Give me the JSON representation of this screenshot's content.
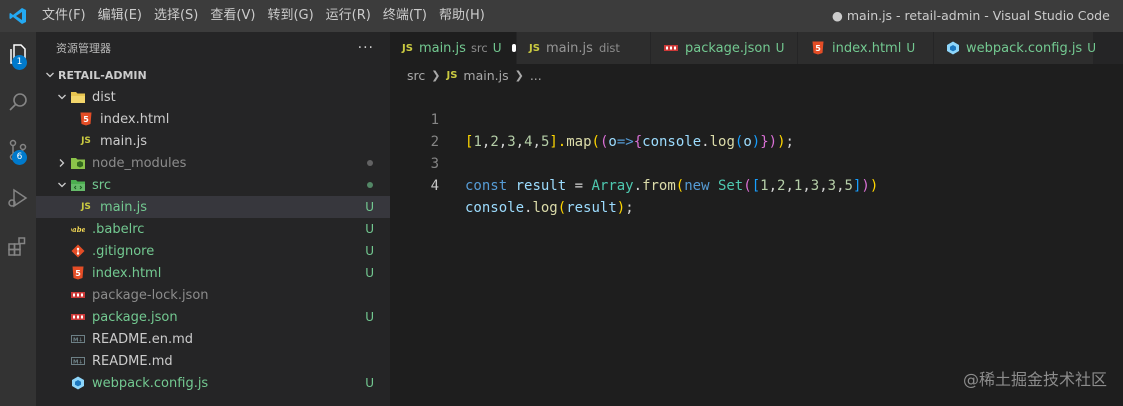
{
  "titlebar": {
    "menu": [
      "文件(F)",
      "编辑(E)",
      "选择(S)",
      "查看(V)",
      "转到(G)",
      "运行(R)",
      "终端(T)",
      "帮助(H)"
    ],
    "window_title": "● main.js - retail-admin - Visual Studio Code"
  },
  "activity": {
    "explorer_badge": "1",
    "scm_badge": "6"
  },
  "sidebar": {
    "header": "资源管理器",
    "more": "···",
    "section": "RETAIL-ADMIN",
    "tree": [
      {
        "label": "dist",
        "status": ""
      },
      {
        "label": "index.html",
        "status": ""
      },
      {
        "label": "main.js",
        "status": ""
      },
      {
        "label": "node_modules",
        "status": ""
      },
      {
        "label": "src",
        "status": ""
      },
      {
        "label": "main.js",
        "status": "U"
      },
      {
        "label": ".babelrc",
        "status": "U"
      },
      {
        "label": ".gitignore",
        "status": "U"
      },
      {
        "label": "index.html",
        "status": "U"
      },
      {
        "label": "package-lock.json",
        "status": ""
      },
      {
        "label": "package.json",
        "status": "U"
      },
      {
        "label": "README.en.md",
        "status": ""
      },
      {
        "label": "README.md",
        "status": ""
      },
      {
        "label": "webpack.config.js",
        "status": "U"
      }
    ]
  },
  "tabs": [
    {
      "icon": "JS",
      "label": "main.js",
      "desc": "src",
      "status": "U"
    },
    {
      "icon": "JS",
      "label": "main.js",
      "desc": "dist",
      "status": ""
    },
    {
      "label": "package.json",
      "status": "U"
    },
    {
      "label": "index.html",
      "status": "U"
    },
    {
      "label": "webpack.config.js",
      "status": "U"
    }
  ],
  "breadcrumb": {
    "folder": "src",
    "file_icon": "JS",
    "file": "main.js",
    "more": "..."
  },
  "editor": {
    "line_numbers": [
      "1",
      "2",
      "3",
      "4"
    ],
    "line1": {
      "p1": "[",
      "p2": "1",
      "p3": ",",
      "p4": "2",
      "p5": ",",
      "p6": "3",
      "p7": ",",
      "p8": "4",
      "p9": ",",
      "p10": "5",
      "p11": "].",
      "p12": "map",
      "p13": "(",
      "p14": "(",
      "p15": "o",
      "p16": "=>",
      "p17": "{",
      "p18": "console",
      "p19": ".",
      "p20": "log",
      "p21": "(",
      "p22": "o",
      "p23": ")",
      "p24": "}",
      "p25": ")",
      "p26": ")",
      "p27": ";"
    },
    "line3": {
      "p1": "const",
      "p2": " ",
      "p3": "result",
      "p4": " = ",
      "p5": "Array",
      "p6": ".",
      "p7": "from",
      "p8": "(",
      "p9": "new",
      "p10": " ",
      "p11": "Set",
      "p12": "(",
      "p13": "[",
      "p14": "1",
      "p15": ",",
      "p16": "2",
      "p17": ",",
      "p18": "1",
      "p19": ",",
      "p20": "3",
      "p21": ",",
      "p22": "3",
      "p23": ",",
      "p24": "5",
      "p25": "]",
      "p26": ")",
      "p27": ")"
    },
    "line4": {
      "p1": "console",
      "p2": ".",
      "p3": "log",
      "p4": "(",
      "p5": "result",
      "p6": ")",
      "p7": ";"
    }
  },
  "watermark": "@稀土掘金技术社区",
  "colors": {
    "accent": "#007acc",
    "untracked": "#73c991",
    "js": "#cbcb41",
    "html": "#e44d26"
  }
}
